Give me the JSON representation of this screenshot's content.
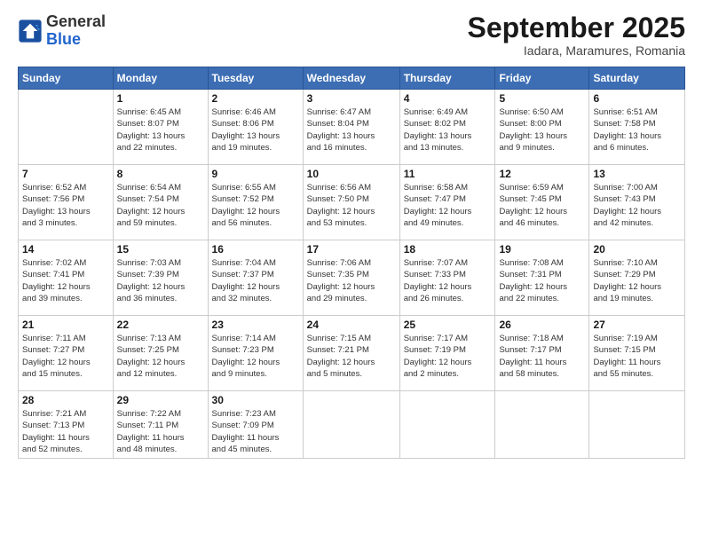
{
  "logo": {
    "line1": "General",
    "line2": "Blue"
  },
  "title": "September 2025",
  "subtitle": "Iadara, Maramures, Romania",
  "days_of_week": [
    "Sunday",
    "Monday",
    "Tuesday",
    "Wednesday",
    "Thursday",
    "Friday",
    "Saturday"
  ],
  "weeks": [
    [
      {
        "day": "",
        "info": ""
      },
      {
        "day": "1",
        "info": "Sunrise: 6:45 AM\nSunset: 8:07 PM\nDaylight: 13 hours\nand 22 minutes."
      },
      {
        "day": "2",
        "info": "Sunrise: 6:46 AM\nSunset: 8:06 PM\nDaylight: 13 hours\nand 19 minutes."
      },
      {
        "day": "3",
        "info": "Sunrise: 6:47 AM\nSunset: 8:04 PM\nDaylight: 13 hours\nand 16 minutes."
      },
      {
        "day": "4",
        "info": "Sunrise: 6:49 AM\nSunset: 8:02 PM\nDaylight: 13 hours\nand 13 minutes."
      },
      {
        "day": "5",
        "info": "Sunrise: 6:50 AM\nSunset: 8:00 PM\nDaylight: 13 hours\nand 9 minutes."
      },
      {
        "day": "6",
        "info": "Sunrise: 6:51 AM\nSunset: 7:58 PM\nDaylight: 13 hours\nand 6 minutes."
      }
    ],
    [
      {
        "day": "7",
        "info": "Sunrise: 6:52 AM\nSunset: 7:56 PM\nDaylight: 13 hours\nand 3 minutes."
      },
      {
        "day": "8",
        "info": "Sunrise: 6:54 AM\nSunset: 7:54 PM\nDaylight: 12 hours\nand 59 minutes."
      },
      {
        "day": "9",
        "info": "Sunrise: 6:55 AM\nSunset: 7:52 PM\nDaylight: 12 hours\nand 56 minutes."
      },
      {
        "day": "10",
        "info": "Sunrise: 6:56 AM\nSunset: 7:50 PM\nDaylight: 12 hours\nand 53 minutes."
      },
      {
        "day": "11",
        "info": "Sunrise: 6:58 AM\nSunset: 7:47 PM\nDaylight: 12 hours\nand 49 minutes."
      },
      {
        "day": "12",
        "info": "Sunrise: 6:59 AM\nSunset: 7:45 PM\nDaylight: 12 hours\nand 46 minutes."
      },
      {
        "day": "13",
        "info": "Sunrise: 7:00 AM\nSunset: 7:43 PM\nDaylight: 12 hours\nand 42 minutes."
      }
    ],
    [
      {
        "day": "14",
        "info": "Sunrise: 7:02 AM\nSunset: 7:41 PM\nDaylight: 12 hours\nand 39 minutes."
      },
      {
        "day": "15",
        "info": "Sunrise: 7:03 AM\nSunset: 7:39 PM\nDaylight: 12 hours\nand 36 minutes."
      },
      {
        "day": "16",
        "info": "Sunrise: 7:04 AM\nSunset: 7:37 PM\nDaylight: 12 hours\nand 32 minutes."
      },
      {
        "day": "17",
        "info": "Sunrise: 7:06 AM\nSunset: 7:35 PM\nDaylight: 12 hours\nand 29 minutes."
      },
      {
        "day": "18",
        "info": "Sunrise: 7:07 AM\nSunset: 7:33 PM\nDaylight: 12 hours\nand 26 minutes."
      },
      {
        "day": "19",
        "info": "Sunrise: 7:08 AM\nSunset: 7:31 PM\nDaylight: 12 hours\nand 22 minutes."
      },
      {
        "day": "20",
        "info": "Sunrise: 7:10 AM\nSunset: 7:29 PM\nDaylight: 12 hours\nand 19 minutes."
      }
    ],
    [
      {
        "day": "21",
        "info": "Sunrise: 7:11 AM\nSunset: 7:27 PM\nDaylight: 12 hours\nand 15 minutes."
      },
      {
        "day": "22",
        "info": "Sunrise: 7:13 AM\nSunset: 7:25 PM\nDaylight: 12 hours\nand 12 minutes."
      },
      {
        "day": "23",
        "info": "Sunrise: 7:14 AM\nSunset: 7:23 PM\nDaylight: 12 hours\nand 9 minutes."
      },
      {
        "day": "24",
        "info": "Sunrise: 7:15 AM\nSunset: 7:21 PM\nDaylight: 12 hours\nand 5 minutes."
      },
      {
        "day": "25",
        "info": "Sunrise: 7:17 AM\nSunset: 7:19 PM\nDaylight: 12 hours\nand 2 minutes."
      },
      {
        "day": "26",
        "info": "Sunrise: 7:18 AM\nSunset: 7:17 PM\nDaylight: 11 hours\nand 58 minutes."
      },
      {
        "day": "27",
        "info": "Sunrise: 7:19 AM\nSunset: 7:15 PM\nDaylight: 11 hours\nand 55 minutes."
      }
    ],
    [
      {
        "day": "28",
        "info": "Sunrise: 7:21 AM\nSunset: 7:13 PM\nDaylight: 11 hours\nand 52 minutes."
      },
      {
        "day": "29",
        "info": "Sunrise: 7:22 AM\nSunset: 7:11 PM\nDaylight: 11 hours\nand 48 minutes."
      },
      {
        "day": "30",
        "info": "Sunrise: 7:23 AM\nSunset: 7:09 PM\nDaylight: 11 hours\nand 45 minutes."
      },
      {
        "day": "",
        "info": ""
      },
      {
        "day": "",
        "info": ""
      },
      {
        "day": "",
        "info": ""
      },
      {
        "day": "",
        "info": ""
      }
    ]
  ]
}
